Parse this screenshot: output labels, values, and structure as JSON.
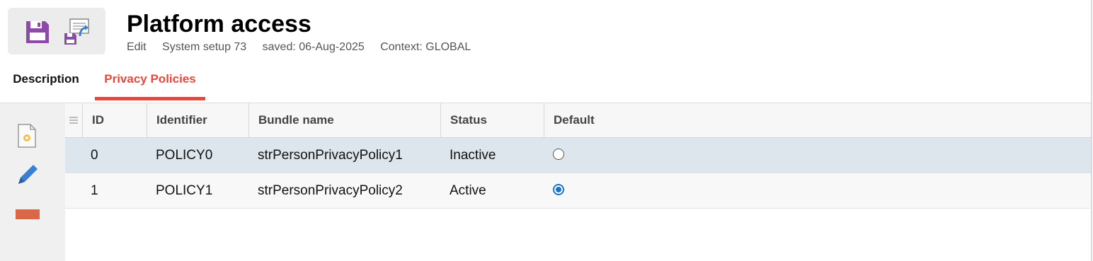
{
  "header": {
    "title": "Platform access",
    "meta": {
      "mode": "Edit",
      "record": "System setup 73",
      "saved": "saved: 06-Aug-2025",
      "context": "Context: GLOBAL"
    },
    "toolbar": {
      "save_icon": "floppy-disk-icon",
      "export_icon": "save-export-icon"
    }
  },
  "tabs": [
    {
      "label": "Description",
      "active": false
    },
    {
      "label": "Privacy Policies",
      "active": true
    }
  ],
  "sidebar_actions": [
    {
      "icon": "new-document-icon"
    },
    {
      "icon": "pencil-icon"
    },
    {
      "icon": "remove-bar-icon"
    }
  ],
  "table": {
    "columns": [
      "ID",
      "Identifier",
      "Bundle name",
      "Status",
      "Default"
    ],
    "rows": [
      {
        "id": "0",
        "identifier": "POLICY0",
        "bundle": "strPersonPrivacyPolicy1",
        "status": "Inactive",
        "default": false
      },
      {
        "id": "1",
        "identifier": "POLICY1",
        "bundle": "strPersonPrivacyPolicy2",
        "status": "Active",
        "default": true
      }
    ]
  },
  "colors": {
    "accent": "#e8473a",
    "selected_row": "#dde6ec",
    "radio_on": "#1a73c8",
    "save_icon": "#8e4aa8"
  }
}
